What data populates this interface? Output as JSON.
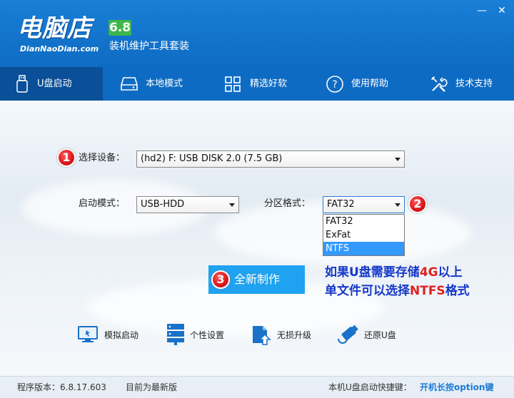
{
  "app": {
    "logo_main": "电脑店",
    "logo_sub": "DianNaoDian.com",
    "version_badge": "6.8",
    "subtitle": "装机维护工具套装"
  },
  "window": {
    "min_glyph": "—",
    "close_glyph": "✕"
  },
  "nav": {
    "items": [
      {
        "label": "U盘启动",
        "icon": "usb-drive-icon",
        "active": true
      },
      {
        "label": "本地模式",
        "icon": "hard-disk-icon",
        "active": false
      },
      {
        "label": "精选好软",
        "icon": "apps-grid-icon",
        "active": false
      },
      {
        "label": "使用帮助",
        "icon": "help-icon",
        "active": false
      },
      {
        "label": "技术支持",
        "icon": "tools-icon",
        "active": false
      }
    ]
  },
  "form": {
    "step1": "1",
    "step2": "2",
    "step3": "3",
    "device_label": "选择设备：",
    "device_value": "(hd2) F: USB DISK 2.0 (7.5 GB)",
    "boot_mode_label": "启动模式：",
    "boot_mode_value": "USB-HDD",
    "partition_label": "分区格式：",
    "partition_value": "FAT32",
    "partition_options": [
      "FAT32",
      "ExFat",
      "NTFS"
    ],
    "partition_highlighted": "NTFS"
  },
  "action": {
    "create_label": "全新制作"
  },
  "tip": {
    "line1_a": "如果U盘需要存储",
    "line1_b": "4G",
    "line1_c": "以上",
    "line2_a": "单文件可以选择",
    "line2_b": "NTFS",
    "line2_c": "格式"
  },
  "tools": [
    {
      "label": "模拟启动",
      "icon": "simulate-boot-icon"
    },
    {
      "label": "个性设置",
      "icon": "personalize-icon"
    },
    {
      "label": "无损升级",
      "icon": "upgrade-icon"
    },
    {
      "label": "还原U盘",
      "icon": "restore-usb-icon"
    }
  ],
  "status": {
    "version_text": "程序版本：6.8.17.603",
    "update_text": "目前为最新版",
    "hotkey_label": "本机U盘启动快捷键：",
    "hotkey_value": "开机长按option键"
  },
  "colors": {
    "brand": "#1273cb",
    "nav_active": "#0a4f97",
    "button": "#1fa2f0",
    "tip_blue": "#1537c8",
    "tip_red": "#e02020",
    "step_red": "#d9151b"
  }
}
